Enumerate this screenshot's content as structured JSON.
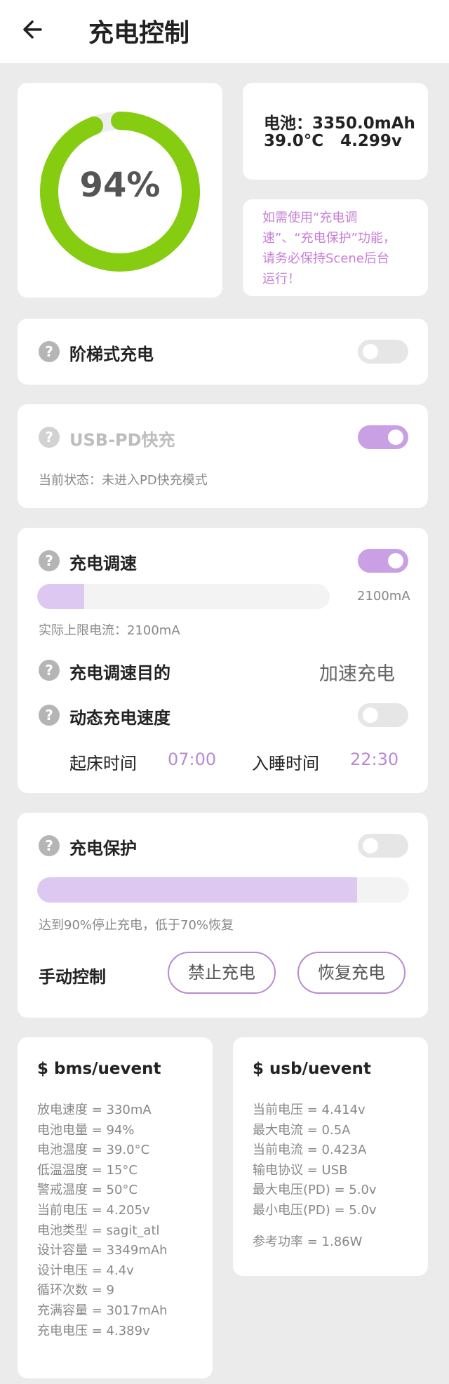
{
  "header": {
    "title": "充电控制"
  },
  "battery": {
    "percent_text": "94%",
    "percent": 94,
    "line1": "电池：3350.0mAh",
    "line2": "39.0°C   4.299v",
    "notice": [
      "如需使用“充电调",
      "速”、“充电保护”功能，",
      "请务必保持Scene后台",
      "运行！"
    ]
  },
  "step_charge": {
    "label": "阶梯式充电",
    "enabled": false
  },
  "usb_pd": {
    "label": "USB-PD快充",
    "enabled": true,
    "status": "当前状态：未进入PD快充模式"
  },
  "speed": {
    "label": "充电调速",
    "enabled": true,
    "value_text": "2100mA",
    "bar_fraction": 0.16,
    "limit_text": "实际上限电流：2100mA",
    "purpose_label": "充电调速目的",
    "purpose_value": "加速充电",
    "dynamic_label": "动态充电速度",
    "dynamic_enabled": false,
    "wake_label": "起床时间",
    "wake_value": "07:00",
    "sleep_label": "入睡时间",
    "sleep_value": "22:30"
  },
  "protect": {
    "label": "充电保护",
    "enabled": false,
    "bar_fraction": 0.86,
    "desc": "达到90%停止充电，低于70%恢复",
    "manual_label": "手动控制",
    "stop_button": "禁止充电",
    "resume_button": "恢复充电"
  },
  "bms": {
    "title": "$ bms/uevent",
    "lines": [
      "放电速度 = 330mA",
      "电池电量 = 94%",
      "电池温度 = 39.0°C",
      "低温温度 = 15°C",
      "警戒温度 = 50°C",
      "当前电压 = 4.205v",
      "电池类型 = sagit_atl",
      "设计容量 = 3349mAh",
      "设计电压 = 4.4v",
      "循环次数 = 9",
      "充满容量 = 3017mAh",
      "充电电压 = 4.389v"
    ]
  },
  "usb": {
    "title": "$ usb/uevent",
    "lines": [
      "当前电压 = 4.414v",
      "最大电流 = 0.5A",
      "当前电流 = 0.423A",
      "输电协议 = USB",
      "最大电压(PD) = 5.0v",
      "最小电压(PD) = 5.0v"
    ],
    "power": "参考功率 = 1.86W"
  },
  "colors": {
    "ring": "#86cc10",
    "accent": "#c9a0e3",
    "notice": "#c77fd6",
    "value": "#b98ad1"
  }
}
